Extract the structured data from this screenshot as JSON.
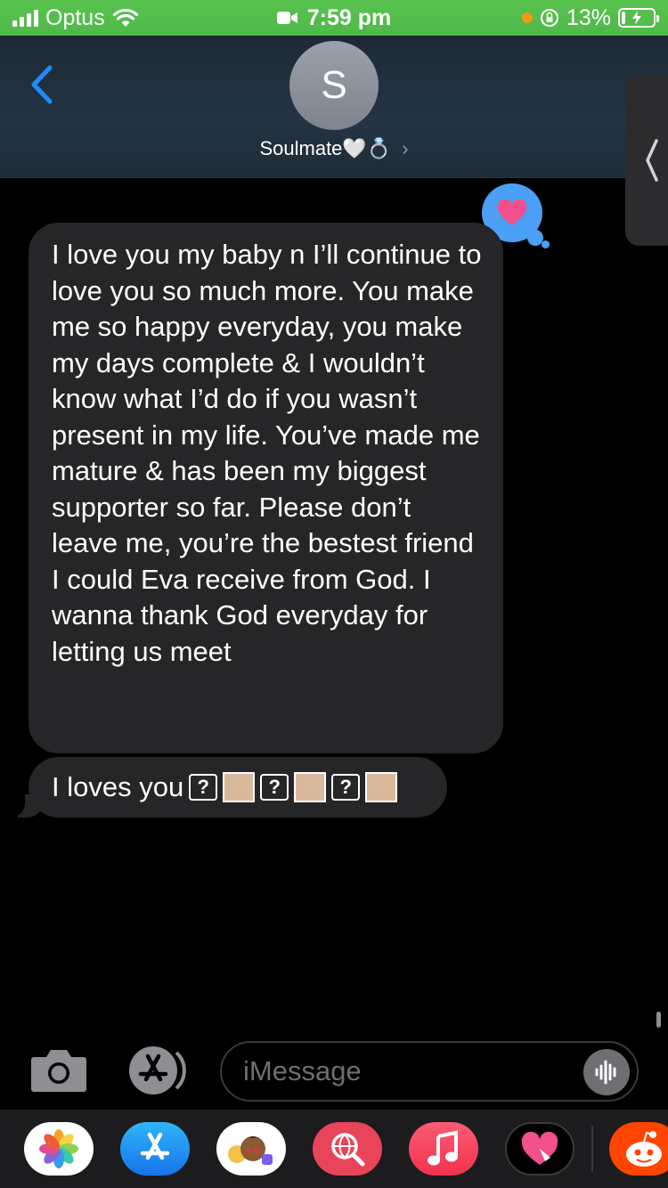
{
  "status_bar": {
    "carrier": "Optus",
    "time": "7:59 pm",
    "battery_percent": "13%",
    "battery_level": 0.13,
    "background_color": "#4fb94a"
  },
  "header": {
    "avatar_initial": "S",
    "contact_name": "Soulmate🤍💍",
    "chevron": "›",
    "back_icon": "chevron-left-icon"
  },
  "side_tab": {
    "glyph": "❮"
  },
  "messages": [
    {
      "direction": "incoming",
      "text": "I love you my baby n I’ll continue to love you so much more. You make me so happy everyday, you make my days complete & I wouldn’t know what I’d do if you wasn’t present in my life. You’ve made me mature & has been my biggest supporter so far. Please don’t leave me, you’re the bestest friend I could Eva receive from God. I wanna thank God everyday for letting us meet",
      "reaction": "heart"
    },
    {
      "direction": "incoming",
      "text": "I loves you",
      "unknown_glyph": "?",
      "emoji_count": 3,
      "skin_tone_color": "#d9b99b"
    }
  ],
  "input": {
    "placeholder": "iMessage",
    "value": ""
  },
  "app_drawer": [
    {
      "name": "Photos",
      "icon": "photos-icon"
    },
    {
      "name": "App Store",
      "icon": "app-store-icon"
    },
    {
      "name": "Memoji",
      "icon": "memoji-icon"
    },
    {
      "name": "Images",
      "icon": "image-search-icon"
    },
    {
      "name": "Music",
      "icon": "music-icon"
    },
    {
      "name": "Digital Touch",
      "icon": "digital-touch-icon"
    },
    {
      "name": "Reddit",
      "icon": "reddit-icon"
    }
  ],
  "colors": {
    "bubble_bg": "#262628",
    "reaction_blue": "#4b9ff5",
    "accent_blue": "#1e8bff"
  }
}
